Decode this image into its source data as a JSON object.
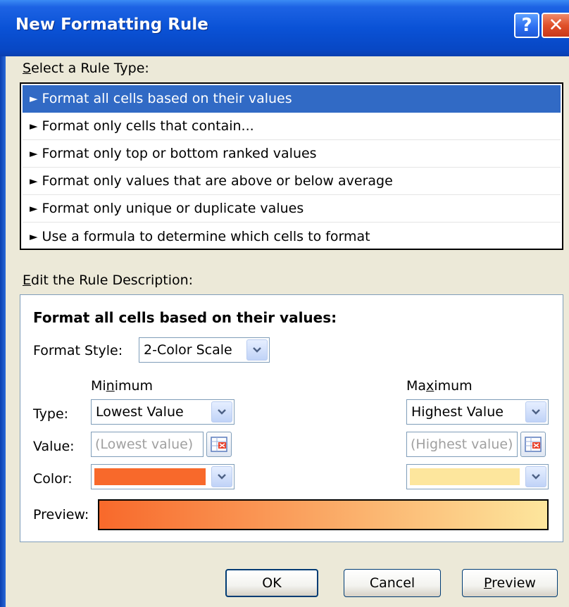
{
  "window": {
    "title": "New Formatting Rule",
    "help_glyph": "?",
    "close_glyph": "✕"
  },
  "select_rule_type": {
    "label_first": "S",
    "label_rest": "elect a Rule Type:",
    "items": [
      {
        "label": "Format all cells based on their values",
        "selected": true
      },
      {
        "label": "Format only cells that contain...",
        "selected": false
      },
      {
        "label": "Format only top or bottom ranked values",
        "selected": false
      },
      {
        "label": "Format only values that are above or below average",
        "selected": false
      },
      {
        "label": "Format only unique or duplicate values",
        "selected": false
      },
      {
        "label": "Use a formula to determine which cells to format",
        "selected": false
      }
    ],
    "arrow_glyph": "►"
  },
  "edit_rule": {
    "label_first": "E",
    "label_rest": "dit the Rule Description:",
    "heading": "Format all cells based on their values:",
    "format_style_label": "Format Style:",
    "format_style_value": "2-Color Scale",
    "minimum": {
      "header_pre": "Mi",
      "header_u": "n",
      "header_post": "imum",
      "type": "Lowest Value",
      "value_placeholder": "(Lowest value)",
      "color": "#f8692b"
    },
    "maximum": {
      "header_pre": "Ma",
      "header_u": "x",
      "header_post": "imum",
      "type": "Highest Value",
      "value_placeholder": "(Highest value)",
      "color": "#fde69d"
    },
    "type_label": "Type:",
    "value_label": "Value:",
    "color_label": "Color:",
    "preview_label": "Preview:"
  },
  "buttons": {
    "ok": "OK",
    "cancel": "Cancel",
    "preview_u": "P",
    "preview_rest": "review"
  },
  "colors": {
    "selection": "#316ac5",
    "title_bar": "#0a52d6",
    "dialog_bg": "#ece9d8"
  }
}
